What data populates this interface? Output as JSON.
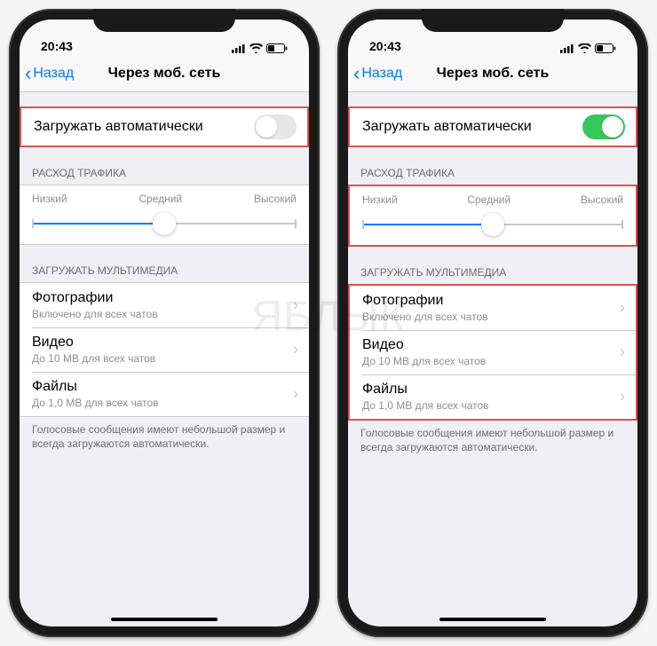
{
  "watermark": "ЯБЛЫК",
  "status": {
    "time": "20:43"
  },
  "nav": {
    "back": "Назад",
    "title": "Через моб. сеть"
  },
  "auto_download": {
    "label": "Загружать автоматически"
  },
  "traffic": {
    "header": "РАСХОД ТРАФИКА",
    "low": "Низкий",
    "medium": "Средний",
    "high": "Высокий"
  },
  "media": {
    "header": "ЗАГРУЖАТЬ МУЛЬТИМЕДИА",
    "photos": {
      "title": "Фотографии",
      "sub": "Включено для всех чатов"
    },
    "videos": {
      "title": "Видео",
      "sub": "До 10 MB для всех чатов"
    },
    "files": {
      "title": "Файлы",
      "sub": "До 1,0 MB для всех чатов"
    },
    "footer": "Голосовые сообщения имеют небольшой размер и всегда загружаются автоматически."
  }
}
